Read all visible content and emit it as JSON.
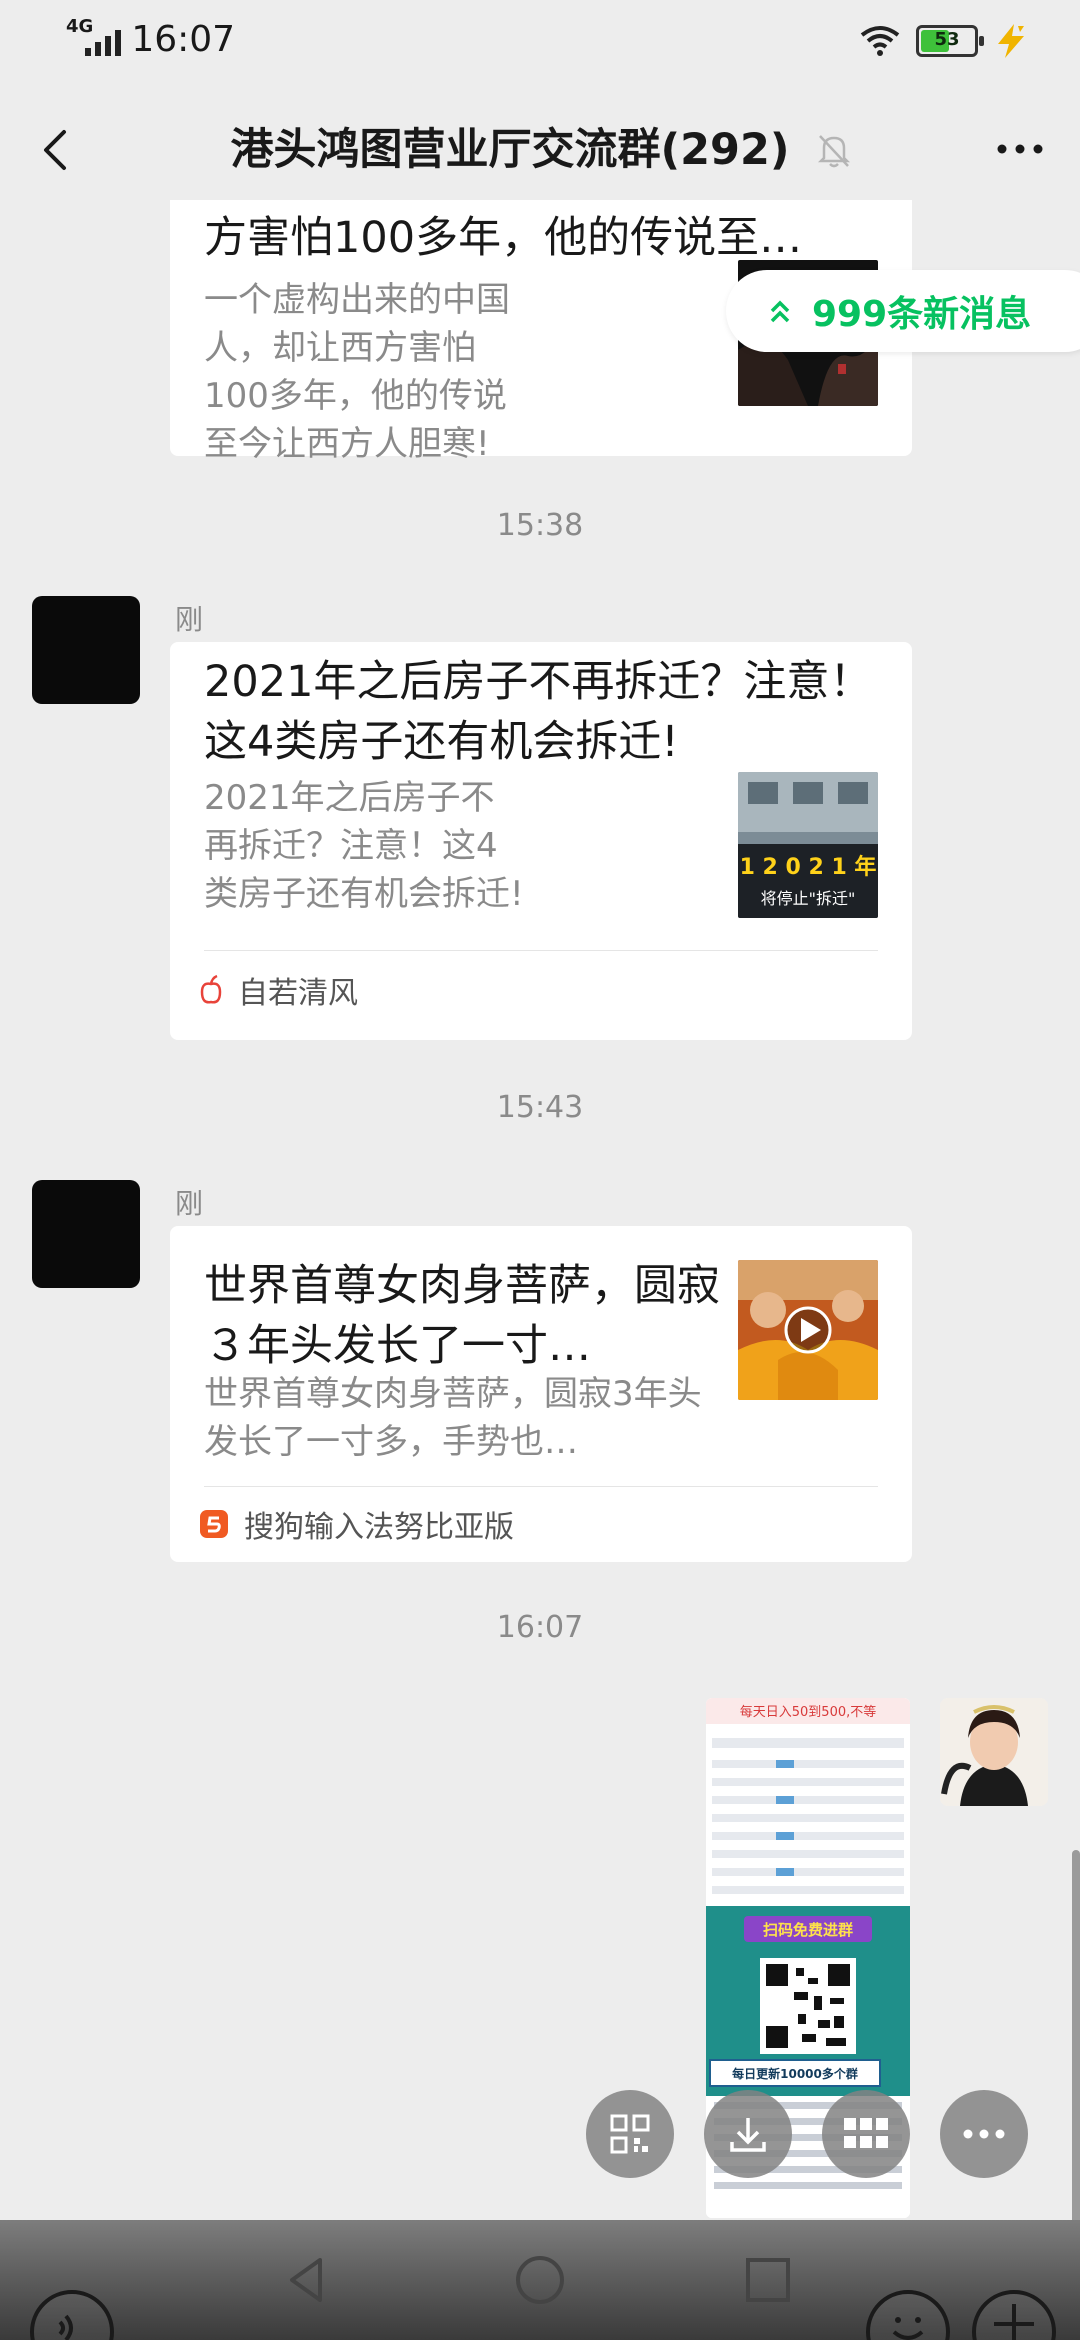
{
  "status_bar": {
    "network": "4G",
    "time": "16:07",
    "battery": "53",
    "battery_level": 0.53
  },
  "header": {
    "title": "港头鸿图营业厅交流群(292)",
    "back_icon": "back-arrow-icon",
    "mute_icon": "bell-off-icon",
    "more_icon": "more-icon"
  },
  "new_messages_pill": {
    "text": "999条新消息",
    "icon": "double-chevron-up-icon",
    "color": "#07c160"
  },
  "messages": [
    {
      "type": "link-card",
      "title": "方害怕100多年，他的传说至…",
      "description": "一个虚构出来的中国人，却让西方害怕100多年，他的传说至今让西方人胆寒!"
    },
    {
      "type": "timestamp",
      "text": "15:38"
    },
    {
      "type": "link-card",
      "sender": "刚",
      "title": "2021年之后房子不再拆迁？注意！这4类房子还有机会拆迁!",
      "description": "2021年之后房子不再拆迁？注意！这4类房子还有机会拆迁!",
      "thumb_caption_top": "1 2 0 2 1 年",
      "thumb_caption_bottom": "将停止\"拆迁\"",
      "source": "自若清风",
      "source_icon": "app-logo-icon"
    },
    {
      "type": "timestamp",
      "text": "15:43"
    },
    {
      "type": "link-card",
      "sender": "刚",
      "title": "世界首尊女肉身菩萨，圆寂３年头发长了一寸…",
      "description": "世界首尊女肉身菩萨，圆寂3年头发长了一寸多，手势也…",
      "source": "搜狗输入法努比亚版",
      "source_icon": "sogou-logo-icon",
      "thumb_icon": "play-icon"
    },
    {
      "type": "timestamp",
      "text": "16:07"
    },
    {
      "type": "image",
      "poster_header": "每天日入50到500,不等",
      "poster_banner": "扫码免费进群",
      "poster_footer": "每日更新10000多个群"
    }
  ],
  "floating_actions": [
    {
      "icon": "qr-code-icon"
    },
    {
      "icon": "download-icon"
    },
    {
      "icon": "grid-icon"
    },
    {
      "icon": "more-icon"
    }
  ],
  "nav": {
    "back_icon": "nav-back-icon",
    "home_icon": "nav-home-icon",
    "recents_icon": "nav-recents-icon"
  }
}
